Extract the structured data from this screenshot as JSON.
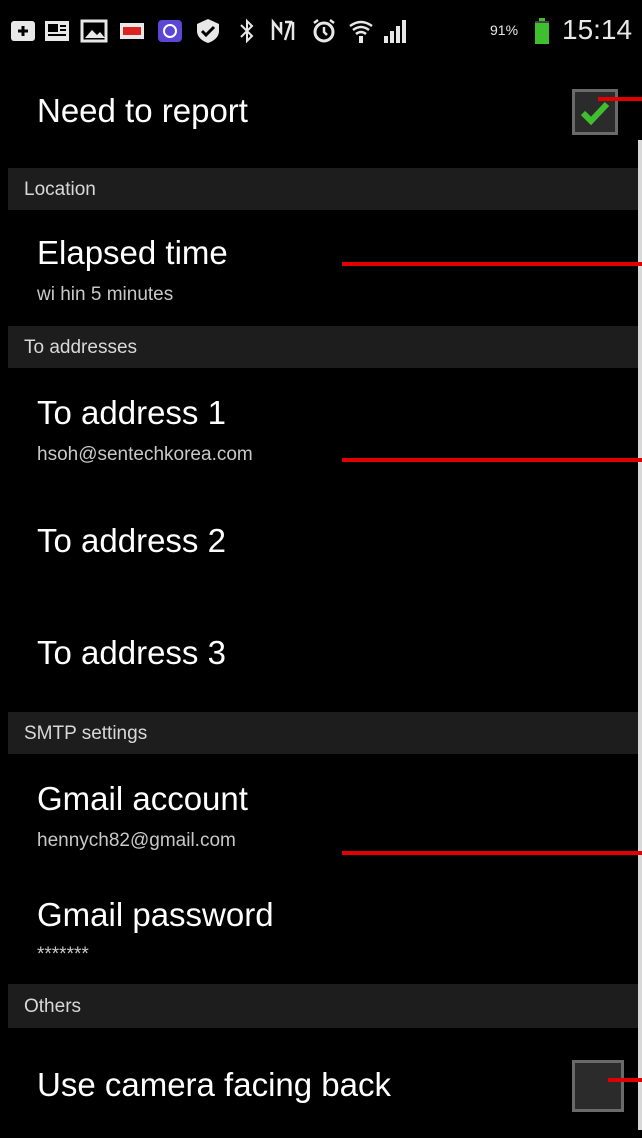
{
  "status_bar": {
    "battery_percent": "91%",
    "time": "15:14",
    "icons": [
      "message-icon",
      "gallery-icon",
      "image-icon",
      "notification-icon",
      "app-icon",
      "check-shield-icon",
      "bluetooth-icon",
      "nfc-icon",
      "alarm-icon",
      "wifi-icon",
      "signal-icon",
      "battery-icon"
    ],
    "battery_level": 0.91
  },
  "settings": {
    "need_to_report": {
      "title": "Need to report",
      "checked": true
    },
    "location_header": "Location",
    "elapsed_time": {
      "title": "Elapsed time",
      "summary": "wi hin 5 minutes"
    },
    "to_addresses_header": "To addresses",
    "to_address_1": {
      "title": "To address 1",
      "summary": "hsoh@sentechkorea.com"
    },
    "to_address_2": {
      "title": "To address 2"
    },
    "to_address_3": {
      "title": "To address 3"
    },
    "smtp_header": "SMTP settings",
    "gmail_account": {
      "title": "Gmail account",
      "summary": "hennych82@gmail.com"
    },
    "gmail_password": {
      "title": "Gmail password",
      "summary": "*******"
    },
    "others_header": "Others",
    "use_camera_back": {
      "title": "Use camera facing back",
      "checked": false
    }
  },
  "colors": {
    "background": "#000000",
    "section_header": "#1d1d1d",
    "check_green": "#3fbf2f",
    "annotation_red": "#e00000"
  }
}
